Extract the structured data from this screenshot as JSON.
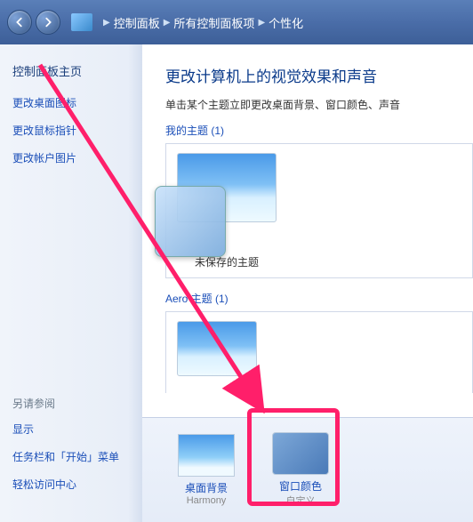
{
  "breadcrumb": {
    "item1": "控制面板",
    "item2": "所有控制面板项",
    "item3": "个性化"
  },
  "sidebar": {
    "title": "控制面板主页",
    "links": [
      "更改桌面图标",
      "更改鼠标指针",
      "更改帐户图片"
    ],
    "see_also_heading": "另请参阅",
    "see_also": [
      "显示",
      "任务栏和「开始」菜单",
      "轻松访问中心"
    ]
  },
  "main": {
    "heading": "更改计算机上的视觉效果和声音",
    "subheading": "单击某个主题立即更改桌面背景、窗口颜色、声音",
    "my_themes_label": "我的主题 (1)",
    "unsaved_theme": "未保存的主题",
    "aero_label": "Aero 主题 (1)"
  },
  "bottom": {
    "desktop_bg_label": "桌面背景",
    "desktop_bg_value": "Harmony",
    "window_color_label": "窗口颜色",
    "window_color_value": "自定义"
  }
}
